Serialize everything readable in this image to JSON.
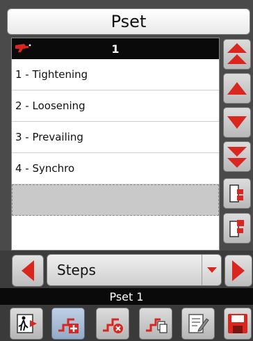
{
  "window": {
    "title": "Pset"
  },
  "list": {
    "header_value": "1",
    "items": [
      {
        "label": "1 - Tightening"
      },
      {
        "label": "2 - Loosening"
      },
      {
        "label": "3 - Prevailing"
      },
      {
        "label": "4 - Synchro"
      }
    ]
  },
  "mode_selector": {
    "value": "Steps"
  },
  "status": {
    "text": "Pset 1"
  },
  "colors": {
    "accent": "#d9271f",
    "header_bg": "#0a0a0a"
  },
  "icons": [
    "tool-icon",
    "scroll-top-icon",
    "scroll-up-icon",
    "scroll-down-icon",
    "scroll-bottom-icon",
    "copy-icon",
    "paste-icon",
    "arrow-left-icon",
    "arrow-right-icon",
    "chevron-down-icon",
    "exit-icon",
    "add-step-icon",
    "delete-step-icon",
    "copy-step-icon",
    "edit-icon",
    "save-icon"
  ]
}
